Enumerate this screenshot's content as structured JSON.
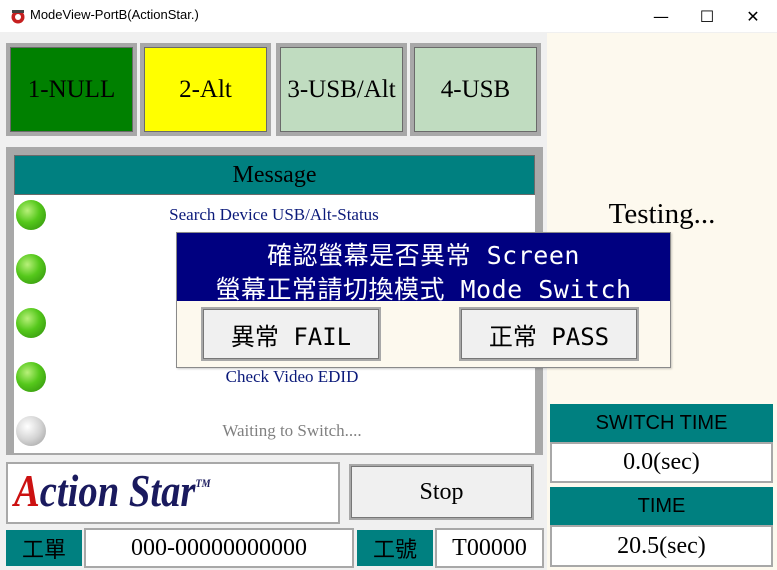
{
  "window": {
    "title": "ModeView-PortB(ActionStar.)",
    "minimize_glyph": "—",
    "maximize_glyph": "☐",
    "close_glyph": "✕"
  },
  "mode_buttons": [
    {
      "label": "1-NULL",
      "color": "#008000"
    },
    {
      "label": "2-Alt",
      "color": "#ffff00"
    },
    {
      "label": "3-USB/Alt",
      "color": "#c0dcc0"
    },
    {
      "label": "4-USB",
      "color": "#c0dcc0"
    }
  ],
  "message": {
    "header": "Message",
    "lines": [
      {
        "text": "Search Device USB/Alt-Status",
        "led": "green"
      },
      {
        "text": "",
        "led": "green"
      },
      {
        "text": "",
        "led": "green"
      },
      {
        "text": "Check Video EDID",
        "led": "green"
      },
      {
        "text": "Waiting to Switch....",
        "led": "gray"
      }
    ]
  },
  "logo": {
    "first_letter": "A",
    "rest": "ction Star",
    "tm": "TM"
  },
  "stop_label": "Stop",
  "work_order": {
    "label": "工單",
    "value": "000-00000000000"
  },
  "work_id": {
    "label": "工號",
    "value": "T00000"
  },
  "status_text": "Testing...",
  "switch_time": {
    "label": "SWITCH TIME",
    "value": "0.0(sec)"
  },
  "time": {
    "label": "TIME",
    "value": "20.5(sec)"
  },
  "dialog": {
    "line1": "確認螢幕是否異常 Screen",
    "line2": "螢幕正常請切換模式 Mode Switch",
    "fail_label": "異常 FAIL",
    "pass_label": "正常 PASS"
  },
  "colors": {
    "teal": "#008080",
    "navy": "#000080",
    "panel_bg": "#fdf9ee"
  }
}
